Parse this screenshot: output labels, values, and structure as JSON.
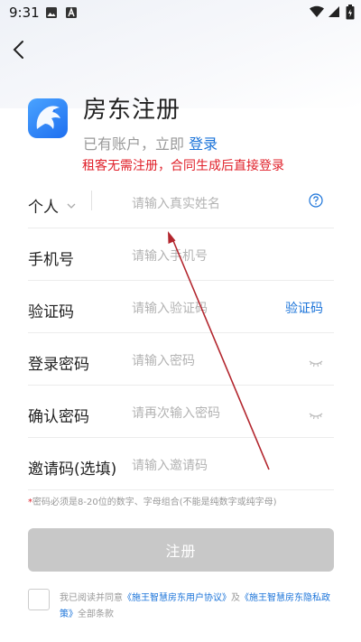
{
  "status_bar": {
    "time": "9:31"
  },
  "header": {
    "title": "房东注册",
    "has_account_text": "已有账户，立即",
    "login_link": "登录",
    "tenant_note": "租客无需注册，合同生成后直接登录"
  },
  "form": {
    "identity_type": "个人",
    "name_placeholder": "请输入真实姓名",
    "phone_label": "手机号",
    "phone_placeholder": "请输入手机号",
    "code_label": "验证码",
    "code_placeholder": "请输入验证码",
    "code_button": "验证码",
    "password_label": "登录密码",
    "password_placeholder": "请输入密码",
    "confirm_label": "确认密码",
    "confirm_placeholder": "请再次输入密码",
    "invite_label": "邀请码(选填)",
    "invite_placeholder": "请输入邀请码",
    "password_hint_star": "*",
    "password_hint": "密码必须是8-20位的数字、字母组合(不能是纯数字或纯字母)"
  },
  "register_button": "注册",
  "agreement": {
    "checked": false,
    "prefix": "我已阅读并同意",
    "user_agreement": "《施王智慧房东用户协议》",
    "and": "及",
    "privacy_policy": "《施王智慧房东隐私政策》",
    "suffix": "全部条款"
  },
  "colors": {
    "link": "#1a73d9",
    "warning": "#e0202a",
    "disabled_button": "#c8c8c8",
    "annotation_arrow": "#b3262e"
  }
}
